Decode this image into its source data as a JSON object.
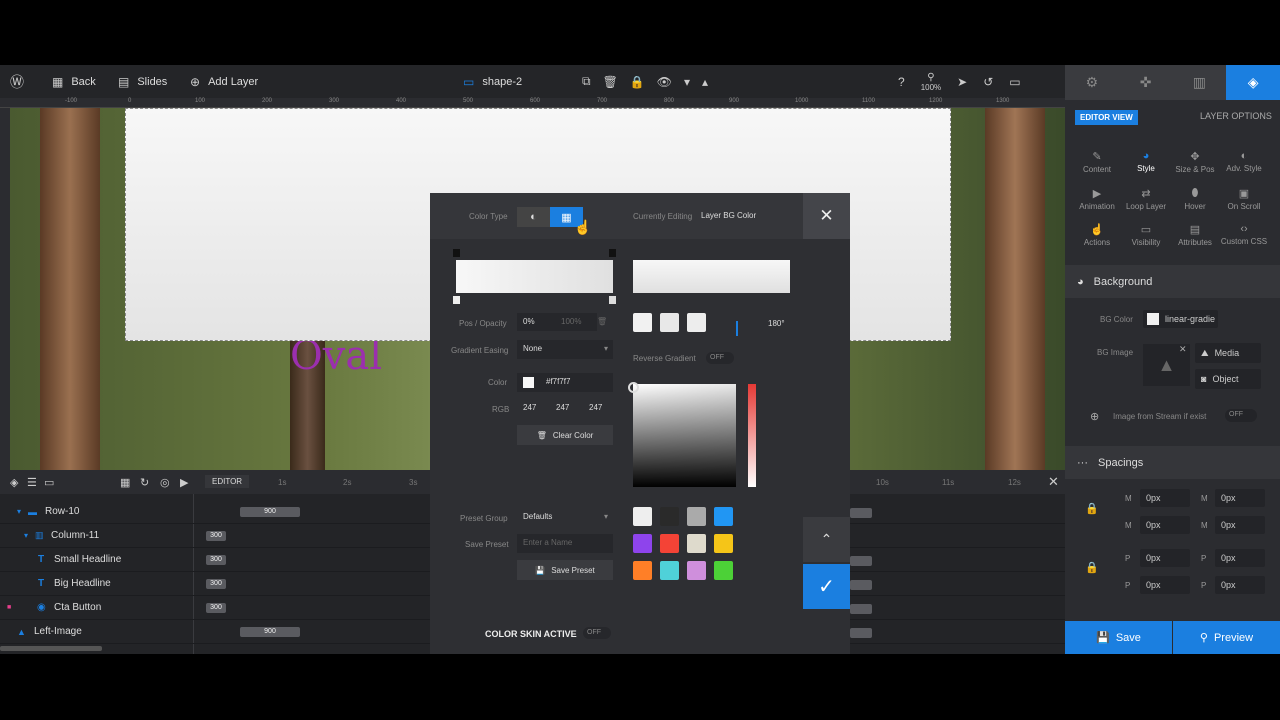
{
  "topbar": {
    "back": "Back",
    "slides": "Slides",
    "add_layer": "Add Layer",
    "layer_name": "shape-2",
    "zoom": "100%"
  },
  "ruler_ticks": [
    "-100",
    "0",
    "100",
    "200",
    "300",
    "400",
    "500",
    "600",
    "700",
    "800",
    "900",
    "1000",
    "1100",
    "1200",
    "1300"
  ],
  "right_panel": {
    "editor_view": "EDITOR VIEW",
    "layer_options": "LAYER OPTIONS",
    "options": [
      {
        "label": "Content",
        "icon": "pencil-icon"
      },
      {
        "label": "Style",
        "icon": "palette-icon"
      },
      {
        "label": "Size & Pos",
        "icon": "move-icon"
      },
      {
        "label": "Adv. Style",
        "icon": "drop-icon"
      },
      {
        "label": "Animation",
        "icon": "play-icon"
      },
      {
        "label": "Loop Layer",
        "icon": "loop-icon"
      },
      {
        "label": "Hover",
        "icon": "mouse-icon"
      },
      {
        "label": "On Scroll",
        "icon": "scroll-icon"
      },
      {
        "label": "Actions",
        "icon": "hand-icon"
      },
      {
        "label": "Visibility",
        "icon": "screen-icon"
      },
      {
        "label": "Attributes",
        "icon": "file-icon"
      },
      {
        "label": "Custom CSS",
        "icon": "code-icon"
      }
    ],
    "background": {
      "title": "Background",
      "bg_color_label": "BG Color",
      "bg_color_value": "linear-gradie",
      "bg_image_label": "BG Image",
      "media": "Media",
      "object": "Object",
      "stream_label": "Image from Stream if exist",
      "stream_toggle": "OFF"
    },
    "spacings": {
      "title": "Spacings",
      "m": "M",
      "p": "P",
      "values": [
        "0px",
        "0px",
        "0px",
        "0px",
        "0px",
        "0px",
        "0px",
        "0px"
      ]
    },
    "save": "Save",
    "preview": "Preview"
  },
  "timeline": {
    "editor_tab": "EDITOR",
    "times": [
      "1s",
      "2s",
      "3s",
      "10s",
      "11s",
      "12s"
    ],
    "rows": [
      {
        "name": "Row-10",
        "value": "900"
      },
      {
        "name": "Column-11",
        "value": "300"
      },
      {
        "name": "Small Headline",
        "value": "300"
      },
      {
        "name": "Big Headline",
        "value": "300"
      },
      {
        "name": "Cta Button",
        "value": "300"
      },
      {
        "name": "Left-Image",
        "value": "900"
      }
    ]
  },
  "modal": {
    "color_type_label": "Color Type",
    "currently_editing_label": "Currently Editing",
    "currently_editing_value": "Layer BG Color",
    "pos_opacity_label": "Pos / Opacity",
    "pos_value": "0%",
    "opacity_value": "100%",
    "gradient_easing_label": "Gradient Easing",
    "gradient_easing_value": "None",
    "color_label": "Color",
    "color_hex": "#f7f7f7",
    "rgb_label": "RGB",
    "r": "247",
    "g": "247",
    "b": "247",
    "clear_color": "Clear Color",
    "angle": "180°",
    "reverse_gradient_label": "Reverse Gradient",
    "reverse_toggle": "OFF",
    "preset_group_label": "Preset Group",
    "preset_group_value": "Defaults",
    "save_preset_label": "Save Preset",
    "preset_placeholder": "Enter a Name",
    "save_preset_button": "Save Preset",
    "color_skin_label": "COLOR SKIN ACTIVE",
    "color_skin_toggle": "OFF",
    "preset_colors": [
      "#eeeeee",
      "#2a2a2a",
      "#aaaaaa",
      "#2196f3",
      "#8e44ec",
      "#f44336",
      "#dedacc",
      "#f5c518",
      "#ff7f27",
      "#4fd1d9",
      "#cf8fdc",
      "#4cd137"
    ]
  }
}
